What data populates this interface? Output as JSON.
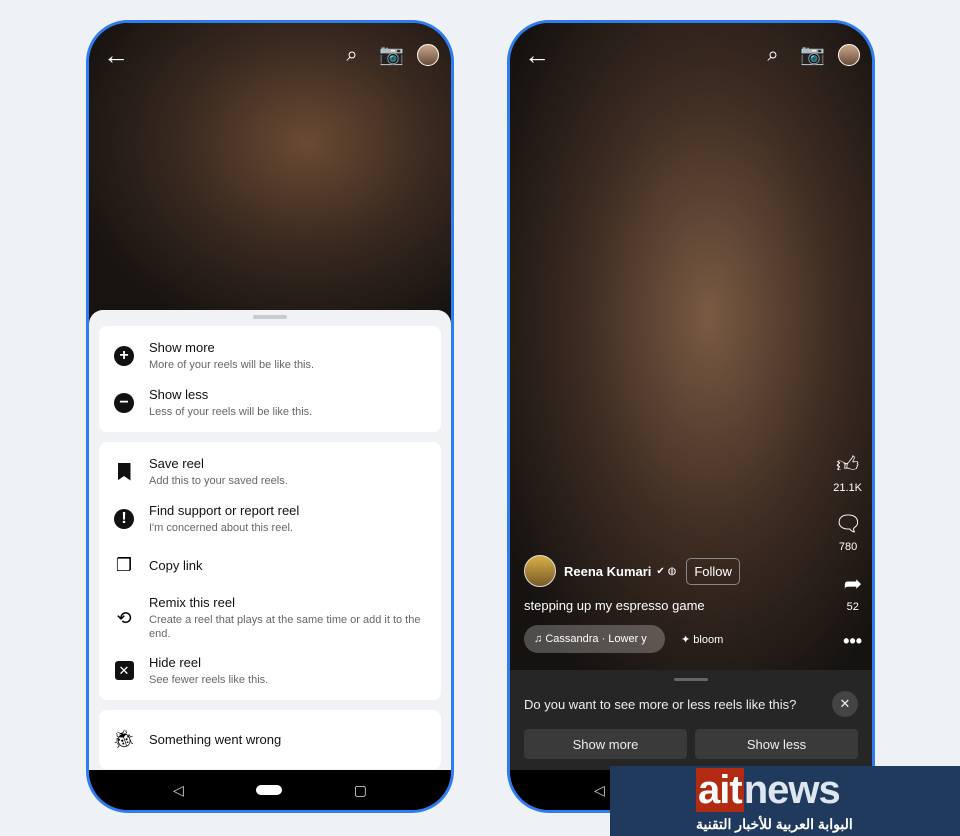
{
  "left": {
    "menu": [
      [
        {
          "icon": "plus-circle-icon",
          "title": "Show more",
          "sub": "More of your reels will be like this."
        },
        {
          "icon": "minus-circle-icon",
          "title": "Show less",
          "sub": "Less of your reels will be like this."
        }
      ],
      [
        {
          "icon": "bookmark-icon",
          "title": "Save reel",
          "sub": "Add this to your saved reels."
        },
        {
          "icon": "alert-icon",
          "title": "Find support or report reel",
          "sub": "I'm concerned about this reel."
        },
        {
          "icon": "copy-icon",
          "title": "Copy link",
          "sub": ""
        },
        {
          "icon": "remix-icon",
          "title": "Remix this reel",
          "sub": "Create a reel that plays at the same time or add it to the end."
        },
        {
          "icon": "close-box-icon",
          "title": "Hide reel",
          "sub": "See fewer reels like this."
        }
      ],
      [
        {
          "icon": "bug-icon",
          "title": "Something went wrong",
          "sub": ""
        }
      ]
    ]
  },
  "right": {
    "likes": "21.1K",
    "comments": "780",
    "shares": "52",
    "author": "Reena Kumari",
    "follow": "Follow",
    "caption": "stepping up my espresso game",
    "music": "Cassandra · Lower y",
    "effect": "bloom",
    "prompt": "Do you want to see more or less reels like this?",
    "show_more": "Show more",
    "show_less": "Show less"
  },
  "watermark": {
    "logo": "aitnews",
    "tagline": "البوابة العربية للأخبار التقنية"
  },
  "colors": {
    "frame": "#2f7cf0",
    "watermark_bg": "#1f3a5c",
    "logo_red": "#b22a12"
  }
}
